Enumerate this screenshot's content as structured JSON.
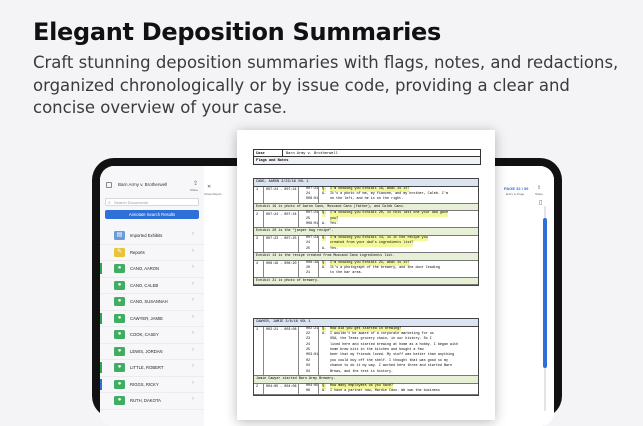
{
  "headline": "Elegant Deposition Summaries",
  "subhead": "Craft stunning deposition summaries with flags, notes, and redactions, organized chronologically or by issue code, providing a clear and concise overview of your case.",
  "sidebar": {
    "title": "Barn Army v. Brotherwell",
    "share_label": "Share",
    "search_placeholder": "Search Documents",
    "search_button": "Annotate Search Results",
    "items": [
      {
        "label": "Imported Exhibits",
        "bar": "",
        "icon_color": "#6b9bd8"
      },
      {
        "label": "Reports",
        "bar": "",
        "icon_color": "#e9c33a"
      },
      {
        "label": "CANO, AARON",
        "bar": "#2fa34d",
        "icon_color": "#3fae63"
      },
      {
        "label": "CANO, CALEB",
        "bar": "",
        "icon_color": "#3fae63"
      },
      {
        "label": "CANO, SUSANNAH",
        "bar": "",
        "icon_color": "#3fae63"
      },
      {
        "label": "CAWYER, JAMIE",
        "bar": "#2fa34d",
        "icon_color": "#3fae63"
      },
      {
        "label": "COOK, CASEY",
        "bar": "",
        "icon_color": "#3fae63"
      },
      {
        "label": "LEWIS, JORDAN",
        "bar": "",
        "icon_color": "#3fae63"
      },
      {
        "label": "LITTLE, ROBERT",
        "bar": "#2fa34d",
        "icon_color": "#3fae63"
      },
      {
        "label": "RIGGS, RICKY",
        "bar": "#2e6fd8",
        "icon_color": "#3fae63"
      },
      {
        "label": "RUTH, DAKOTA",
        "bar": "",
        "icon_color": "#3fae63"
      }
    ]
  },
  "canvas": {
    "close_label": "Close Report",
    "page_label": "PAGE 32 / 39",
    "fit_label": "Entry to Page",
    "share_label": "Share"
  },
  "document": {
    "case_key": "Case",
    "case_value": "Barn Army v. Brotherwell",
    "flags_label": "Flags and Notes",
    "sections": [
      {
        "header": "CANO, AARON 2/23/16 VOL 1",
        "entries": [
          {
            "num": "1",
            "pg": "007:24 - 007:24",
            "lines": [
              {
                "ln": "007:23",
                "qa": "Q.",
                "tx": "I'm showing you Exhibit 19, what is it?",
                "hl": true
              },
              {
                "ln": "24",
                "qa": "A.",
                "tx": "It's a photo of me, my fiancee, and my brother, Caleb. I'm",
                "hl": false
              },
              {
                "ln": "008:01",
                "qa": "",
                "tx": "on the left, and he is on the right.",
                "hl": false
              }
            ],
            "note": "Exhibit 19 is photo of Aaron Cano, Muscaod Cano (father), and Caleb Cano."
          },
          {
            "num": "2",
            "pg": "007:24 - 007:24",
            "lines": [
              {
                "ln": "007:24",
                "qa": "Q.",
                "tx": "I'm showing you Exhibit 20, is this last one your dad gave",
                "hl": true
              },
              {
                "ln": "25",
                "qa": "",
                "tx": "you?",
                "hl": true
              },
              {
                "ln": "008:01",
                "qa": "A.",
                "tx": "Yes.",
                "hl": false
              }
            ],
            "note": "Exhibit 20 is the \"jasper bag recipe\"."
          },
          {
            "num": "3",
            "pg": "007:23 - 007:25",
            "lines": [
              {
                "ln": "007:23",
                "qa": "Q.",
                "tx": "I'm showing you Exhibit 14, is it the recipe you",
                "hl": true
              },
              {
                "ln": "24",
                "qa": "",
                "tx": "created from your dad's ingredients list?",
                "hl": true
              },
              {
                "ln": "25",
                "qa": "A.",
                "tx": "Yes.",
                "hl": false
              }
            ],
            "note": "Exhibit 14 is the recipe created from Muscaod Cano ingredients list."
          },
          {
            "num": "4",
            "pg": "008:19 - 008:20",
            "lines": [
              {
                "ln": "008:19",
                "qa": "Q.",
                "tx": "I'm showing you Exhibit 21, what is it?",
                "hl": true
              },
              {
                "ln": "20",
                "qa": "A.",
                "tx": "It's a photograph of the brewery, and the door leading",
                "hl": false
              },
              {
                "ln": "21",
                "qa": "",
                "tx": "to the bar area.",
                "hl": false
              }
            ],
            "note": "Exhibit 21 is photo of brewery."
          }
        ]
      },
      {
        "header": "CAWYER, JAMIE 3/8/16 VOL 1",
        "entries": [
          {
            "num": "1",
            "pg": "002:21 - 003:08",
            "lines": [
              {
                "ln": "002:21",
                "qa": "Q.",
                "tx": "How did you get started in brewing?",
                "hl": true
              },
              {
                "ln": "22",
                "qa": "A.",
                "tx": "I wouldn't be aware of a corporate marketing for us",
                "hl": false
              },
              {
                "ln": "23",
                "qa": "",
                "tx": "USA, the Texas grocery chain, in our history. So I",
                "hl": false
              },
              {
                "ln": "24",
                "qa": "",
                "tx": "lived here and started brewing at home as a hobby. I began with",
                "hl": false
              },
              {
                "ln": "25",
                "qa": "",
                "tx": "home brew kits in the kitchen and bought a few",
                "hl": false
              },
              {
                "ln": "003:01",
                "qa": "",
                "tx": "beer that my friends loved. My stuff was better than anything",
                "hl": false
              },
              {
                "ln": "02",
                "qa": "",
                "tx": "you could buy off the shelf. I thought that was good so my",
                "hl": false
              },
              {
                "ln": "03",
                "qa": "",
                "tx": "chance to do it my way. I worked here three and started Barn",
                "hl": false
              },
              {
                "ln": "04",
                "qa": "",
                "tx": "Brews, and the rest is history.",
                "hl": false
              }
            ],
            "note": "Jamie Cawyer started Barn Army Brewery."
          },
          {
            "num": "2",
            "pg": "004:05 - 004:06",
            "lines": [
              {
                "ln": "004:05",
                "qa": "Q.",
                "tx": "How many employees do you have?",
                "hl": true
              },
              {
                "ln": "06",
                "qa": "A.",
                "tx": "I have a partner now, Mardie Cano. We own the business",
                "hl": false
              }
            ],
            "note": ""
          }
        ]
      }
    ]
  },
  "colors": {
    "accent": "#2e6fd8",
    "highlight": "#f3f79b",
    "section_header": "#dbe4f1",
    "note_fill": "#e8efd7"
  }
}
